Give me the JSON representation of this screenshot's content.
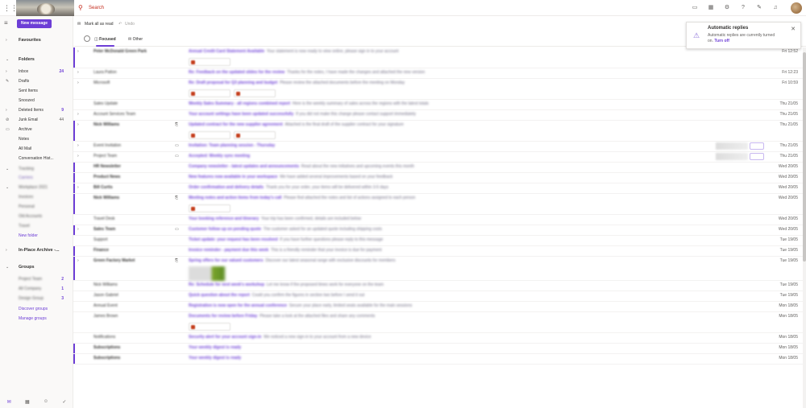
{
  "topbar": {
    "search_placeholder": "Search",
    "icons": [
      "meet-now-icon",
      "calendar-icon",
      "settings-icon",
      "help-icon",
      "feedback-icon",
      "bell-icon"
    ]
  },
  "nav": {
    "new_message": "New message",
    "favourites": "Favourites",
    "folders": "Folders",
    "items": [
      {
        "label": "Inbox",
        "count": "24"
      },
      {
        "label": "Drafts",
        "count": ""
      },
      {
        "label": "Sent Items",
        "count": ""
      },
      {
        "label": "Snoozed",
        "count": ""
      },
      {
        "label": "Deleted Items",
        "count": "9"
      },
      {
        "label": "Junk Email",
        "count": "44"
      },
      {
        "label": "Archive",
        "count": ""
      },
      {
        "label": "Notes",
        "count": ""
      },
      {
        "label": "All Mail",
        "count": ""
      },
      {
        "label": "Conversation Hist...",
        "count": ""
      }
    ],
    "blurred_items": [
      "Tracking",
      "Carriers",
      "Workplace 2021",
      "Invoices",
      "Personal",
      "Old Accounts",
      "Travel"
    ],
    "new_folder": "New folder",
    "in_place_archive": "In-Place Archive -...",
    "groups": "Groups",
    "blurred_groups": [
      {
        "label": "Project Team",
        "count": "2"
      },
      {
        "label": "All Company",
        "count": "1"
      },
      {
        "label": "Design Group",
        "count": "3"
      }
    ],
    "discover_groups": "Discover groups",
    "manage_groups": "Manage groups"
  },
  "commandbar": {
    "mark_all_read": "Mark all as read",
    "undo": "Undo"
  },
  "tabs": {
    "focused": "Focused",
    "other": "Other"
  },
  "toast": {
    "title": "Automatic replies",
    "message": "Automatic replies are currently turned on.",
    "turn_off": "Turn off"
  },
  "mails": [
    {
      "sender": "Peter McDonald Green Park",
      "subject": "Annual Credit Card Statement Available",
      "preview": "Your statement is now ready to view online, please sign in to your account",
      "date": "Fri 12:52",
      "unread": true,
      "chev": true,
      "attachments": 1
    },
    {
      "sender": "Laura Patton",
      "subject": "Re: Feedback on the updated slides for the review",
      "preview": "Thanks for the notes, I have made the changes and attached the new version",
      "date": "Fri 12:23",
      "unread": false,
      "chev": true,
      "attachments": 0
    },
    {
      "sender": "Microsoft",
      "subject": "Re: Draft proposal for Q3 planning and budget",
      "preview": "Please review the attached documents before the meeting on Monday",
      "date": "Fri 10:59",
      "unread": false,
      "chev": true,
      "attachments": 2
    },
    {
      "sender": "Sales Update",
      "subject": "Weekly Sales Summary - all regions combined report",
      "preview": "Here is the weekly summary of sales across the regions with the latest totals",
      "date": "Thu 21/05",
      "unread": false,
      "chev": false,
      "attachments": 0
    },
    {
      "sender": "Account Services Team",
      "subject": "Your account settings have been updated successfully",
      "preview": "If you did not make this change please contact support immediately",
      "date": "Thu 21/05",
      "unread": false,
      "chev": true,
      "attachments": 0
    },
    {
      "sender": "Nick Williams",
      "subject": "Updated contract for the new supplier agreement",
      "preview": "Attached is the final draft of the supplier contract for your signature",
      "date": "Thu 21/05",
      "unread": true,
      "chev": true,
      "attachments": 2,
      "clip": true
    },
    {
      "sender": "Event Invitation",
      "subject": "Invitation: Team planning session - Thursday",
      "preview": "",
      "date": "Thu 21/05",
      "unread": false,
      "chev": true,
      "attachments": 0,
      "rsvp": true,
      "cal": true
    },
    {
      "sender": "Project Team",
      "subject": "Accepted: Weekly sync meeting",
      "preview": "",
      "date": "Thu 21/05",
      "unread": false,
      "chev": true,
      "attachments": 0,
      "rsvp": true,
      "cal": true
    },
    {
      "sender": "HR Newsletter",
      "subject": "Company newsletter - latest updates and announcements",
      "preview": "Read about the new initiatives and upcoming events this month",
      "date": "Wed 20/05",
      "unread": true,
      "chev": false,
      "attachments": 0
    },
    {
      "sender": "Product News",
      "subject": "New features now available in your workspace",
      "preview": "We have added several improvements based on your feedback",
      "date": "Wed 20/05",
      "unread": true,
      "chev": false,
      "attachments": 0
    },
    {
      "sender": "Bill Curtis",
      "subject": "Order confirmation and delivery details",
      "preview": "Thank you for your order, your items will be delivered within 3-5 days",
      "date": "Wed 20/05",
      "unread": true,
      "chev": true,
      "attachments": 0
    },
    {
      "sender": "Nick Williams",
      "subject": "Meeting notes and action items from today's call",
      "preview": "Please find attached the notes and list of actions assigned to each person",
      "date": "Wed 20/05",
      "unread": true,
      "chev": false,
      "attachments": 1,
      "clip": true
    },
    {
      "sender": "Travel Desk",
      "subject": "Your booking reference and itinerary",
      "preview": "Your trip has been confirmed, details are included below",
      "date": "Wed 20/05",
      "unread": false,
      "chev": false,
      "attachments": 0
    },
    {
      "sender": "Sales Team",
      "subject": "Customer follow up on pending quote",
      "preview": "The customer asked for an updated quote including shipping costs",
      "date": "Wed 20/05",
      "unread": true,
      "chev": true,
      "attachments": 0,
      "cal": true
    },
    {
      "sender": "Support",
      "subject": "Ticket update: your request has been resolved",
      "preview": "If you have further questions please reply to this message",
      "date": "Tue 19/05",
      "unread": false,
      "chev": false,
      "attachments": 0
    },
    {
      "sender": "Finance",
      "subject": "Invoice reminder - payment due this week",
      "preview": "This is a friendly reminder that your invoice is due for payment",
      "date": "Tue 19/05",
      "unread": true,
      "chev": false,
      "attachments": 0
    },
    {
      "sender": "Green Factory Market",
      "subject": "Spring offers for our valued customers",
      "preview": "Discover our latest seasonal range with exclusive discounts for members",
      "date": "Tue 19/05",
      "unread": true,
      "chev": true,
      "attachments": 0,
      "clip": true,
      "image": true
    },
    {
      "sender": "Nick Williams",
      "subject": "Re: Schedule for next week's workshop",
      "preview": "Let me know if the proposed times work for everyone on the team",
      "date": "Tue 19/05",
      "unread": false,
      "chev": false,
      "attachments": 0
    },
    {
      "sender": "Jason Gabriel",
      "subject": "Quick question about the report",
      "preview": "Could you confirm the figures in section two before I send it out",
      "date": "Tue 19/05",
      "unread": false,
      "chev": false,
      "attachments": 0
    },
    {
      "sender": "Annual Event",
      "subject": "Registration is now open for the annual conference",
      "preview": "Secure your place early, limited seats available for the main sessions",
      "date": "Mon 18/05",
      "unread": false,
      "chev": false,
      "attachments": 0
    },
    {
      "sender": "James Brown",
      "subject": "Documents for review before Friday",
      "preview": "Please take a look at the attached files and share any comments",
      "date": "Mon 18/05",
      "unread": false,
      "chev": false,
      "attachments": 1
    },
    {
      "sender": "Notifications",
      "subject": "Security alert for your account sign-in",
      "preview": "We noticed a new sign-in to your account from a new device",
      "date": "Mon 18/05",
      "unread": false,
      "chev": false,
      "attachments": 0
    },
    {
      "sender": "Subscriptions",
      "subject": "Your weekly digest is ready",
      "preview": "",
      "date": "Mon 18/05",
      "unread": true,
      "chev": false,
      "attachments": 0
    },
    {
      "sender": "Subscriptions",
      "subject": "Your weekly digest is ready",
      "preview": "",
      "date": "Mon 18/05",
      "unread": true,
      "chev": false,
      "attachments": 0
    }
  ],
  "colors": {
    "accent": "#6d3ed6",
    "brand": "#6d3ed6"
  }
}
